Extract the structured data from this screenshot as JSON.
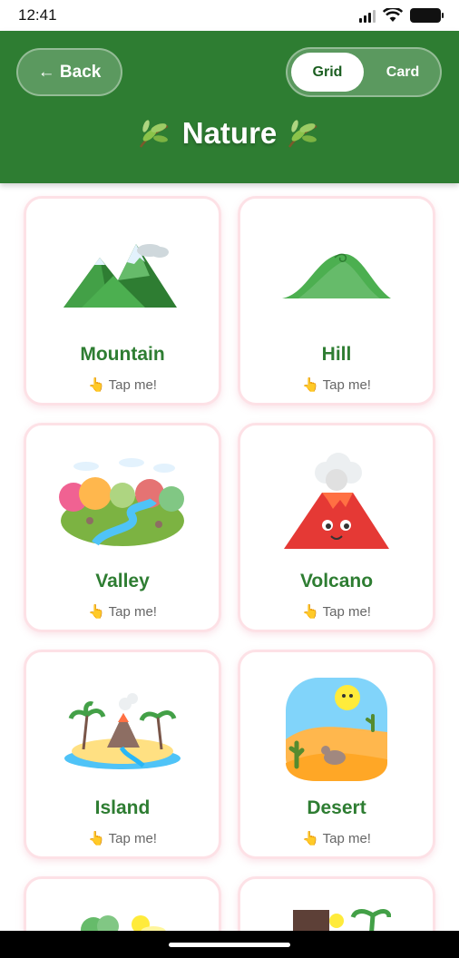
{
  "status": {
    "time": "12:41"
  },
  "header": {
    "back_label": "← Back",
    "toggle": {
      "grid_label": "Grid",
      "card_label": "Card",
      "selected": "Grid"
    },
    "title": "Nature",
    "title_icon": "leaf-icon"
  },
  "items": [
    {
      "title": "Mountain",
      "hint": "Tap me!",
      "icon": "mountain-icon"
    },
    {
      "title": "Hill",
      "hint": "Tap me!",
      "icon": "hill-icon"
    },
    {
      "title": "Valley",
      "hint": "Tap me!",
      "icon": "valley-icon"
    },
    {
      "title": "Volcano",
      "hint": "Tap me!",
      "icon": "volcano-icon"
    },
    {
      "title": "Island",
      "hint": "Tap me!",
      "icon": "island-icon"
    },
    {
      "title": "Desert",
      "hint": "Tap me!",
      "icon": "desert-icon"
    }
  ],
  "colors": {
    "header_bg": "#2e7d32",
    "title_green": "#2e7d32",
    "card_border": "#fde1e6"
  }
}
